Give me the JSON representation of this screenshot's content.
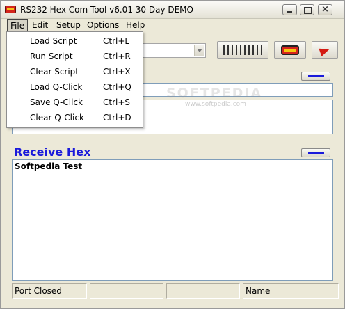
{
  "window": {
    "title": "RS232 Hex Com Tool v6.01 30 Day DEMO"
  },
  "menubar": {
    "items": [
      "File",
      "Edit",
      "Setup",
      "Options",
      "Help"
    ],
    "active": "File"
  },
  "file_menu": {
    "items": [
      {
        "label": "Load Script",
        "shortcut": "Ctrl+L"
      },
      {
        "label": "Run Script",
        "shortcut": "Ctrl+R"
      },
      {
        "label": "Clear Script",
        "shortcut": "Ctrl+X"
      },
      {
        "label": "Load Q-Click",
        "shortcut": "Ctrl+Q"
      },
      {
        "label": "Save Q-Click",
        "shortcut": "Ctrl+S"
      },
      {
        "label": "Clear Q-Click",
        "shortcut": "Ctrl+D"
      }
    ]
  },
  "toolbar": {
    "icons": [
      "port-lines-icon",
      "serial-port-icon",
      "send-arrow-icon"
    ]
  },
  "receive": {
    "title": "Receive Hex",
    "content": "Softpedia Test"
  },
  "watermark": {
    "main": "SOFTPEDIA",
    "url": "www.softpedia.com"
  },
  "statusbar": {
    "port_status": "Port Closed",
    "name_label": "Name"
  },
  "colors": {
    "section_title": "#1a1adb",
    "accent_red": "#d4251c",
    "window_bg": "#ece9d8"
  }
}
